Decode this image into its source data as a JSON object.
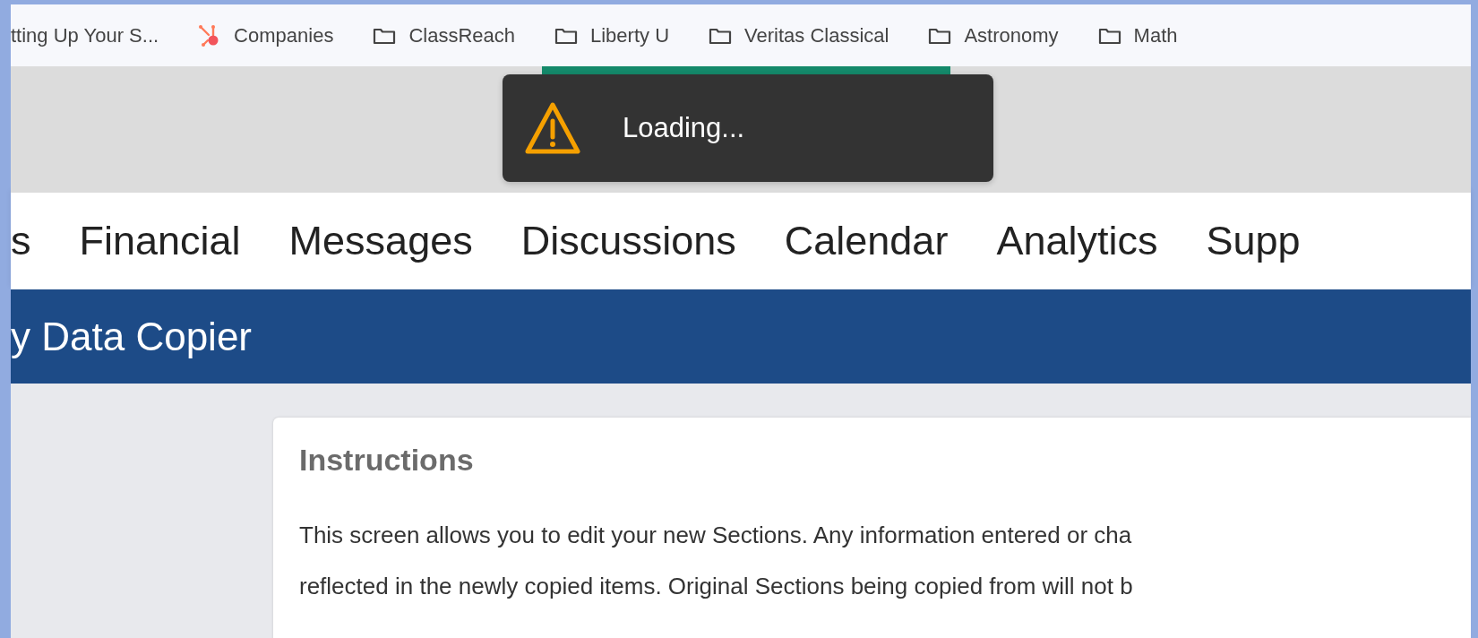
{
  "bookmarks": [
    {
      "label": "tting Up Your S...",
      "kind": "plain"
    },
    {
      "label": "Companies",
      "kind": "hub"
    },
    {
      "label": "ClassReach",
      "kind": "folder"
    },
    {
      "label": "Liberty U",
      "kind": "folder"
    },
    {
      "label": "Veritas Classical",
      "kind": "folder"
    },
    {
      "label": "Astronomy",
      "kind": "folder"
    },
    {
      "label": "Math",
      "kind": "folder"
    }
  ],
  "toast": {
    "message": "Loading..."
  },
  "nav": [
    {
      "label": "s"
    },
    {
      "label": "Financial"
    },
    {
      "label": "Messages"
    },
    {
      "label": "Discussions"
    },
    {
      "label": "Calendar"
    },
    {
      "label": "Analytics"
    },
    {
      "label": "Supp"
    }
  ],
  "banner": {
    "title": "y Data Copier"
  },
  "card": {
    "title": "Instructions",
    "lines": [
      "This screen allows you to edit your new Sections. Any information entered or cha",
      "reflected in the newly copied items. Original Sections being copied from will not b"
    ]
  }
}
